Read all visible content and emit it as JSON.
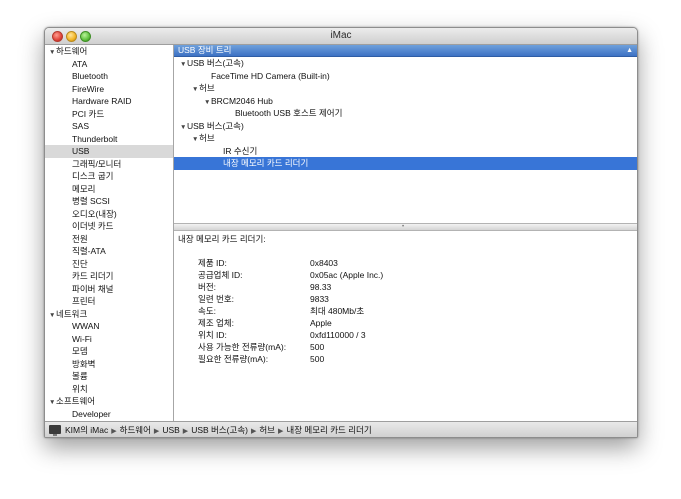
{
  "window": {
    "title": "iMac"
  },
  "sidebar": {
    "groups": [
      {
        "label": "하드웨어",
        "items": [
          "ATA",
          "Bluetooth",
          "FireWire",
          "Hardware RAID",
          "PCI 카드",
          "SAS",
          "Thunderbolt",
          "USB",
          "그래픽/모니터",
          "디스크 굽기",
          "메모리",
          "병렬 SCSI",
          "오디오(내장)",
          "이더넷 카드",
          "전원",
          "직렬-ATA",
          "진단",
          "카드 리더기",
          "파이버 채널",
          "프린터"
        ]
      },
      {
        "label": "네트워크",
        "items": [
          "WWAN",
          "Wi-Fi",
          "모뎀",
          "방화벽",
          "볼륨",
          "위치"
        ]
      },
      {
        "label": "소프트웨어",
        "items": [
          "Developer"
        ]
      }
    ],
    "selected_item": "USB"
  },
  "usb_tree": {
    "header": "USB 장비 트리",
    "rows": [
      {
        "label": "USB 버스(고속)",
        "indent": 0,
        "disclosure": true
      },
      {
        "label": "FaceTime HD Camera (Built-in)",
        "indent": 2,
        "disclosure": false
      },
      {
        "label": "허브",
        "indent": 1,
        "disclosure": true
      },
      {
        "label": "BRCM2046 Hub",
        "indent": 2,
        "disclosure": true
      },
      {
        "label": "Bluetooth USB 호스트 제어기",
        "indent": 4,
        "disclosure": false
      },
      {
        "label": "USB 버스(고속)",
        "indent": 0,
        "disclosure": true
      },
      {
        "label": "허브",
        "indent": 1,
        "disclosure": true
      },
      {
        "label": "IR 수신기",
        "indent": 3,
        "disclosure": false
      },
      {
        "label": "내장 메모리 카드 리더기",
        "indent": 3,
        "disclosure": false,
        "selected": true
      }
    ]
  },
  "detail": {
    "title": "내장 메모리 카드 리더기:",
    "rows": [
      {
        "label": "제품 ID:",
        "value": "0x8403"
      },
      {
        "label": "공급업체 ID:",
        "value": "0x05ac  (Apple Inc.)"
      },
      {
        "label": "버전:",
        "value": "98.33"
      },
      {
        "label": "일련 번호:",
        "value": "9833"
      },
      {
        "label": "속도:",
        "value": "최대 480Mb/초"
      },
      {
        "label": "제조 업체:",
        "value": "Apple"
      },
      {
        "label": "위치 ID:",
        "value": "0xfd110000 / 3"
      },
      {
        "label": "사용 가능한 전류량(mA):",
        "value": "500"
      },
      {
        "label": "필요한 전류량(mA):",
        "value": "500"
      }
    ]
  },
  "statusbar": {
    "breadcrumbs": [
      "KIM의 iMac",
      "하드웨어",
      "USB",
      "USB 버스(고속)",
      "허브",
      "내장 메모리 카드 리더기"
    ]
  },
  "icons": {
    "computer": "imac-icon",
    "disclosure_open": "disclosure-triangle-icon",
    "sort": "sort-arrow-icon"
  }
}
